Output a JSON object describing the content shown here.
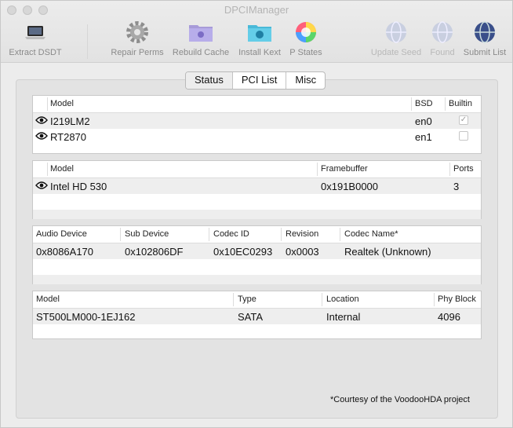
{
  "window": {
    "title": "DPCIManager"
  },
  "toolbar": {
    "extract_dsdt": "Extract DSDT",
    "repair_perms": "Repair Perms",
    "rebuild_cache": "Rebuild Cache",
    "install_kext": "Install Kext",
    "p_states": "P States",
    "update_seed": "Update Seed",
    "found": "Found",
    "submit_list": "Submit List"
  },
  "tabs": [
    "Status",
    "PCI List",
    "Misc"
  ],
  "network": {
    "headers": {
      "model": "Model",
      "bsd": "BSD",
      "builtin": "Builtin"
    },
    "rows": [
      {
        "model": "I219LM2",
        "bsd": "en0",
        "builtin": true
      },
      {
        "model": "RT2870",
        "bsd": "en1",
        "builtin": false
      }
    ]
  },
  "graphics": {
    "headers": {
      "model": "Model",
      "framebuffer": "Framebuffer",
      "ports": "Ports"
    },
    "rows": [
      {
        "model": "Intel HD 530",
        "framebuffer": "0x191B0000",
        "ports": "3"
      }
    ]
  },
  "audio": {
    "headers": {
      "audio_device": "Audio Device",
      "sub_device": "Sub Device",
      "codec_id": "Codec ID",
      "revision": "Revision",
      "codec_name": "Codec Name*"
    },
    "rows": [
      {
        "audio_device": "0x8086A170",
        "sub_device": "0x102806DF",
        "codec_id": "0x10EC0293",
        "revision": "0x0003",
        "codec_name": "Realtek (Unknown)"
      }
    ]
  },
  "storage": {
    "headers": {
      "model": "Model",
      "type": "Type",
      "location": "Location",
      "phy_block": "Phy Block"
    },
    "rows": [
      {
        "model": "ST500LM000-1EJ162",
        "type": "SATA",
        "location": "Internal",
        "phy_block": "4096"
      }
    ]
  },
  "footnote": "*Courtesy of the VoodooHDA project"
}
